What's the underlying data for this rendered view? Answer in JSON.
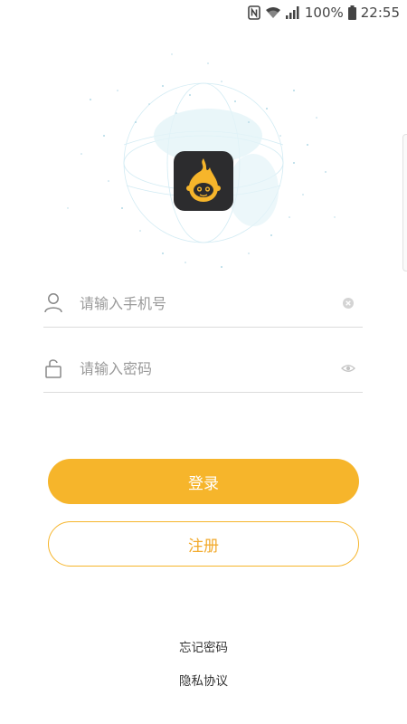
{
  "status_bar": {
    "battery_percent": "100%",
    "time": "22:55",
    "icons": [
      "nfc-icon",
      "wifi-icon",
      "signal-icon",
      "battery-icon"
    ]
  },
  "login": {
    "phone_placeholder": "请输入手机号",
    "password_placeholder": "请输入密码",
    "login_label": "登录",
    "register_label": "注册",
    "forgot_password_label": "忘记密码",
    "privacy_label": "隐私协议"
  },
  "colors": {
    "accent": "#f6b52b",
    "logo_bg": "#2c2c2e"
  }
}
